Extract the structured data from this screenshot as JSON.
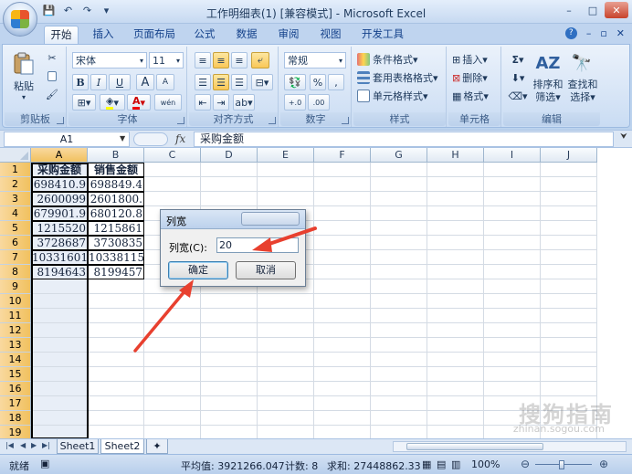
{
  "window": {
    "title": "工作明细表(1)  [兼容模式] - Microsoft Excel",
    "min": "–",
    "max": "□",
    "close": "✕"
  },
  "qat": {
    "save": "💾",
    "undo": "↶",
    "redo": "↷",
    "more": "▾"
  },
  "tabs": [
    "开始",
    "插入",
    "页面布局",
    "公式",
    "数据",
    "审阅",
    "视图",
    "开发工具"
  ],
  "tab_right": {
    "help": "?",
    "min": "–",
    "restore": "▫",
    "close": "✕"
  },
  "ribbon": {
    "clipboard": {
      "label": "剪贴板",
      "paste": "粘贴"
    },
    "font": {
      "label": "字体",
      "name": "宋体",
      "size": "11",
      "bold": "B",
      "italic": "I",
      "underline": "U",
      "grow": "A",
      "shrink": "A",
      "wen": "wén",
      "fontcolor": "A"
    },
    "alignment": {
      "label": "对齐方式"
    },
    "number": {
      "label": "数字",
      "format": "常规",
      "percent": "%",
      "comma": ",",
      "inc": "+.0",
      "dec": ".00"
    },
    "styles": {
      "label": "样式",
      "conditional": "条件格式",
      "table": "套用表格格式",
      "cell": "单元格样式"
    },
    "cells": {
      "label": "单元格",
      "insert": "插入",
      "delete": "删除",
      "format": "格式"
    },
    "editing": {
      "label": "编辑",
      "sigma": "Σ",
      "sort": "排序和",
      "sort2": "筛选",
      "find": "查找和",
      "find2": "选择"
    }
  },
  "formula_bar": {
    "name_box": "A1",
    "fx": "fx",
    "value": "采购金额"
  },
  "columns": [
    "A",
    "B",
    "C",
    "D",
    "E",
    "F",
    "G",
    "H",
    "I",
    "J"
  ],
  "rows": [
    "1",
    "2",
    "3",
    "4",
    "5",
    "6",
    "7",
    "8",
    "9",
    "10",
    "11",
    "12",
    "13",
    "14",
    "15",
    "16",
    "17",
    "18",
    "19"
  ],
  "cells": {
    "A1": "采购金额",
    "B1": "销售金额",
    "A2": "698410.9",
    "B2": "698849.4",
    "A3": "2600099",
    "B3": "2601800.",
    "A4": "679901.9",
    "B4": "680120.8",
    "A5": "1215520",
    "B5": "1215861",
    "A6": "3728687",
    "B6": "3730835",
    "A7": "10331601",
    "B7": "10338115",
    "A8": "8194643",
    "B8": "8199457"
  },
  "dialog": {
    "title": "列宽",
    "label": "列宽(C):",
    "value": "20",
    "ok": "确定",
    "cancel": "取消"
  },
  "sheets": [
    "Sheet1",
    "Sheet2"
  ],
  "active_sheet": "Sheet2",
  "status": {
    "ready": "就绪",
    "average": "平均值: 3921266.047",
    "count": "计数: 8",
    "sum": "求和: 27448862.33",
    "zoom": "100%"
  },
  "watermark": {
    "text": "搜狗指南",
    "url": "zhinan.sogou.com"
  },
  "colors": {
    "accent": "#e8402f",
    "ribbon": "#d6e4f6",
    "selection": "#f1c15f"
  }
}
